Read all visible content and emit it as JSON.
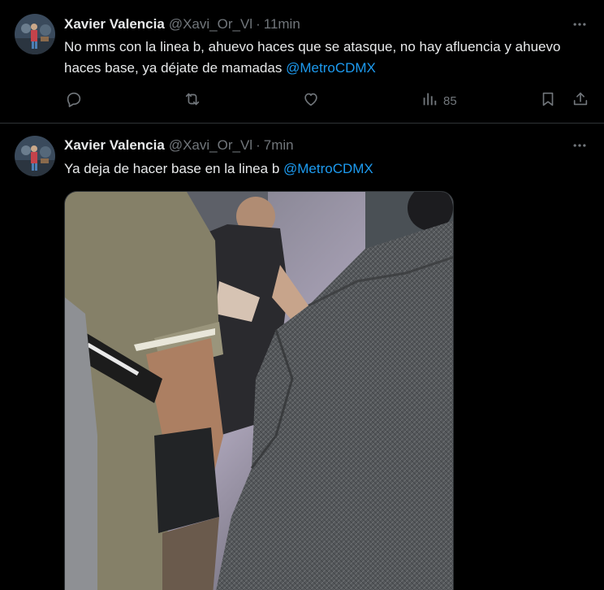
{
  "tweets": [
    {
      "author": "Xavier Valencia",
      "handle": "@Xavi_Or_Vl",
      "separator": "·",
      "time": "11min",
      "text": "No mms con la linea b, ahuevo haces que se atasque, no hay afluencia y ahuevo haces base, ya déjate de mamadas ",
      "mention": "@MetroCDMX",
      "views": "85",
      "icons": [
        "reply-icon",
        "retweet-icon",
        "like-icon",
        "views-icon",
        "bookmark-icon",
        "share-icon"
      ]
    },
    {
      "author": "Xavier Valencia",
      "handle": "@Xavi_Or_Vl",
      "separator": "·",
      "time": "7min",
      "text": "Ya deja de hacer base en la linea b ",
      "mention": "@MetroCDMX",
      "media": "photo"
    }
  ],
  "colors": {
    "background": "#000000",
    "text": "#e7e9ea",
    "muted": "#71767b",
    "link": "#1d9bf0",
    "divider": "#2f3336"
  }
}
